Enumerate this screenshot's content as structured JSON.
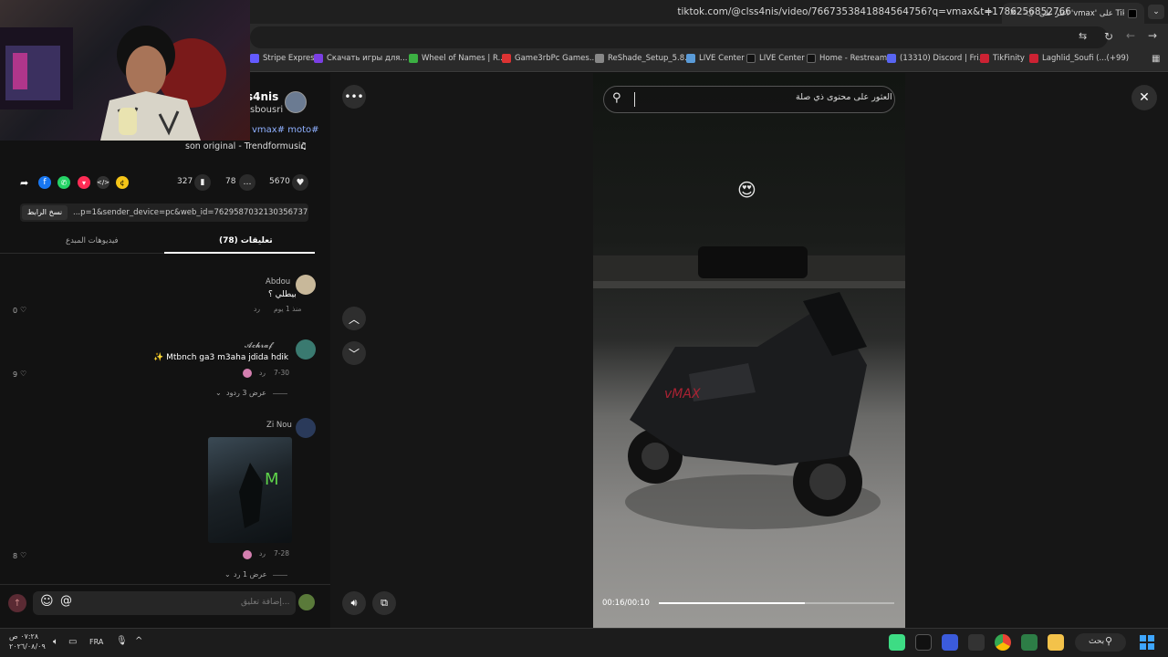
{
  "browser": {
    "tab_title": "اعثر على 'vmax' على TikTok",
    "url": "tiktok.com/@clss4nis/video/7667353841884564756?q=vmax&t=1786256852766",
    "bookmarks": [
      {
        "label": "Stripe Express",
        "color": "#635bff"
      },
      {
        "label": "Скачать игры для...",
        "color": "#7b3fe4"
      },
      {
        "label": "Wheel of Names | R...",
        "color": "#3cb043"
      },
      {
        "label": "Game3rbPc Games...",
        "color": "#d33"
      },
      {
        "label": "ReShade_Setup_5.8.0",
        "color": "#888"
      },
      {
        "label": "LIVE Center",
        "color": "#5a9bd8"
      },
      {
        "label": "LIVE Center",
        "color": "#111"
      },
      {
        "label": "Home - Restream",
        "color": "#111"
      },
      {
        "label": "(13310) Discord | Fri...",
        "color": "#5865f2"
      },
      {
        "label": "TikFinity",
        "color": "#c23"
      },
      {
        "label": "Laghlid_Soufi (...(+99)",
        "color": "#c23"
      }
    ]
  },
  "author": {
    "name": "s4nis",
    "handle": "sbousri",
    "tags": "vmax# moto#",
    "sound": "son original - Trendformusic"
  },
  "stats": {
    "likes": "5670",
    "comments": "78",
    "saves": "327"
  },
  "share": {
    "link_text": "...p=1&sender_device=pc&web_id=7629587032130356737",
    "copy_label": "نسخ الرابط"
  },
  "tabs": {
    "comments": "(78) تعليقات",
    "creator_videos": "فيديوهات المبدع"
  },
  "comments": [
    {
      "user": "Abdou",
      "text": "بيطلي ؟",
      "meta": "منذ 1 يوم",
      "reply": "رد",
      "likes": "0"
    },
    {
      "user": "𝓐𝓬𝓱𝓻𝓪𝓯",
      "text": "✨ Mtbnch ga3 m3aha jdida hdik",
      "meta": "7-30",
      "reply": "رد",
      "likes": "9",
      "more": "عرض 3 ردود"
    },
    {
      "user": "Zi Nou",
      "text": "",
      "meta": "7-28",
      "reply": "رد",
      "likes": "8",
      "more": "عرض 1 رد"
    }
  ],
  "composer": {
    "placeholder": "إضافة تعليق..."
  },
  "video": {
    "search_placeholder": "العثور على محتوى ذي صلة",
    "time": "00:16/00:10",
    "progress": 0.62,
    "emoji": "😍"
  },
  "taskbar": {
    "time": "٠٧:٢٨ ص",
    "date": "٢٠٢٦/٠٨/٠٩",
    "lang": "FRA",
    "search": "بحث"
  }
}
